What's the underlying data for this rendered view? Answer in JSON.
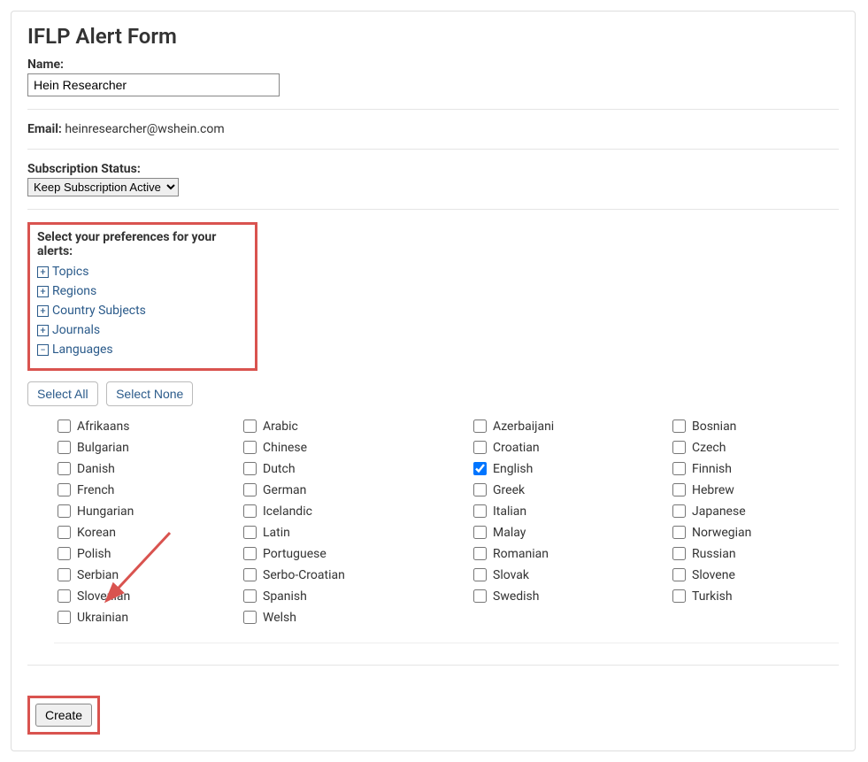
{
  "title": "IFLP Alert Form",
  "name": {
    "label": "Name:",
    "value": "Hein Researcher"
  },
  "email": {
    "label": "Email:",
    "value": "heinresearcher@wshein.com"
  },
  "subscription": {
    "label": "Subscription Status:",
    "selected": "Keep Subscription Active"
  },
  "prefs": {
    "label": "Select your preferences for your alerts:",
    "items": [
      {
        "label": "Topics",
        "expanded": false
      },
      {
        "label": "Regions",
        "expanded": false
      },
      {
        "label": "Country Subjects",
        "expanded": false
      },
      {
        "label": "Journals",
        "expanded": false
      },
      {
        "label": "Languages",
        "expanded": true
      }
    ]
  },
  "buttons": {
    "select_all": "Select All",
    "select_none": "Select None",
    "create": "Create"
  },
  "languages": [
    {
      "label": "Afrikaans",
      "checked": false
    },
    {
      "label": "Arabic",
      "checked": false
    },
    {
      "label": "Azerbaijani",
      "checked": false
    },
    {
      "label": "Bosnian",
      "checked": false
    },
    {
      "label": "Bulgarian",
      "checked": false
    },
    {
      "label": "Chinese",
      "checked": false
    },
    {
      "label": "Croatian",
      "checked": false
    },
    {
      "label": "Czech",
      "checked": false
    },
    {
      "label": "Danish",
      "checked": false
    },
    {
      "label": "Dutch",
      "checked": false
    },
    {
      "label": "English",
      "checked": true
    },
    {
      "label": "Finnish",
      "checked": false
    },
    {
      "label": "French",
      "checked": false
    },
    {
      "label": "German",
      "checked": false
    },
    {
      "label": "Greek",
      "checked": false
    },
    {
      "label": "Hebrew",
      "checked": false
    },
    {
      "label": "Hungarian",
      "checked": false
    },
    {
      "label": "Icelandic",
      "checked": false
    },
    {
      "label": "Italian",
      "checked": false
    },
    {
      "label": "Japanese",
      "checked": false
    },
    {
      "label": "Korean",
      "checked": false
    },
    {
      "label": "Latin",
      "checked": false
    },
    {
      "label": "Malay",
      "checked": false
    },
    {
      "label": "Norwegian",
      "checked": false
    },
    {
      "label": "Polish",
      "checked": false
    },
    {
      "label": "Portuguese",
      "checked": false
    },
    {
      "label": "Romanian",
      "checked": false
    },
    {
      "label": "Russian",
      "checked": false
    },
    {
      "label": "Serbian",
      "checked": false
    },
    {
      "label": "Serbo-Croatian",
      "checked": false
    },
    {
      "label": "Slovak",
      "checked": false
    },
    {
      "label": "Slovene",
      "checked": false
    },
    {
      "label": "Slovenian",
      "checked": false
    },
    {
      "label": "Spanish",
      "checked": false
    },
    {
      "label": "Swedish",
      "checked": false
    },
    {
      "label": "Turkish",
      "checked": false
    },
    {
      "label": "Ukrainian",
      "checked": false
    },
    {
      "label": "Welsh",
      "checked": false
    }
  ],
  "annotation": {
    "arrow_color": "#d9534f"
  }
}
